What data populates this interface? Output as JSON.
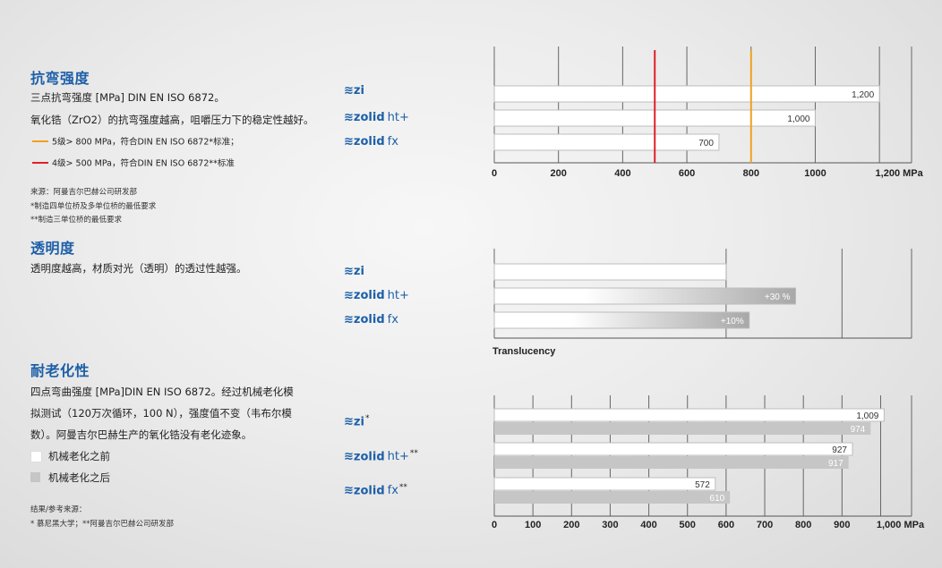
{
  "colors": {
    "heading": "#1d5fa8",
    "orange": "#f0a020",
    "red": "#e0202a",
    "before": "#ffffff",
    "after": "#c6c6c6"
  },
  "s1": {
    "title": "抗弯强度",
    "line1": "三点抗弯强度 [MPa] DIN EN ISO 6872。",
    "line2": "氧化锆（ZrO2）的抗弯强度越高，咀嚼压力下的稳定性越好。",
    "legend_orange": "5级> 800 MPa，符合DIN EN ISO 6872*标准；",
    "legend_red": "4级> 500 MPa，符合DIN EN ISO 6872**标准",
    "src1": "来源：阿曼吉尔巴赫公司研发部",
    "src2": "*制造四单位桥及多单位桥的最低要求",
    "src3": "**制造三单位桥的最低要求"
  },
  "s2": {
    "title": "透明度",
    "line1": "透明度越高，材质对光（透明）的透过性越强。"
  },
  "s3": {
    "title": "耐老化性",
    "line1": "四点弯曲强度 [MPa]DIN EN ISO 6872。经过机械老化模",
    "line2": "拟测试（120万次循环，100 N），强度值不变（韦布尔模",
    "line3": "数）。阿曼吉尔巴赫生产的氧化锆没有老化迹象。",
    "legend_before": "机械老化之前",
    "legend_after": "机械老化之后",
    "src1": "结果/参考来源：",
    "src2": "* 慕尼黑大学；**阿曼吉尔巴赫公司研发部"
  },
  "brands": {
    "mark": "≋",
    "zi": "zi",
    "zolid": "zolid",
    "ht": "ht+",
    "fx": "fx",
    "ast1": "*",
    "ast2": "**"
  },
  "chart_data": [
    {
      "type": "bar",
      "categories": [
        "zi",
        "zolid ht+",
        "zolid fx"
      ],
      "values": [
        1200,
        1000,
        700
      ],
      "value_labels": [
        "1,200",
        "1,000",
        "700"
      ],
      "xlim": [
        0,
        1300
      ],
      "xticks": [
        0,
        200,
        400,
        600,
        800,
        1000,
        1200
      ],
      "xtick_labels": [
        "0",
        "200",
        "400",
        "600",
        "800",
        "1000",
        "1,200 MPa"
      ],
      "reference_lines": [
        {
          "value": 500,
          "color": "#e0202a"
        },
        {
          "value": 800,
          "color": "#f0a020"
        }
      ],
      "grid": true
    },
    {
      "type": "bar",
      "categories": [
        "zi",
        "zolid ht+",
        "zolid fx"
      ],
      "values": [
        100,
        130,
        110
      ],
      "value_labels": [
        "",
        "+30 %",
        "+10%"
      ],
      "xlim": [
        0,
        180
      ],
      "gridlines": [
        100,
        150
      ],
      "xlabel": "Translucency",
      "grid": true
    },
    {
      "type": "bar",
      "categories": [
        "zi*",
        "zolid ht+**",
        "zolid fx**"
      ],
      "series": [
        {
          "values": [
            1009,
            927,
            572
          ],
          "labels": [
            "1,009",
            "927",
            "572"
          ]
        },
        {
          "values": [
            974,
            917,
            610
          ],
          "labels": [
            "974",
            "917",
            "610"
          ]
        }
      ],
      "xlim": [
        0,
        1080
      ],
      "xticks": [
        0,
        100,
        200,
        300,
        400,
        500,
        600,
        700,
        800,
        900,
        1000
      ],
      "xtick_labels": [
        "0",
        "100",
        "200",
        "300",
        "400",
        "500",
        "600",
        "700",
        "800",
        "900",
        "1,000 MPa"
      ],
      "grid": true
    }
  ]
}
